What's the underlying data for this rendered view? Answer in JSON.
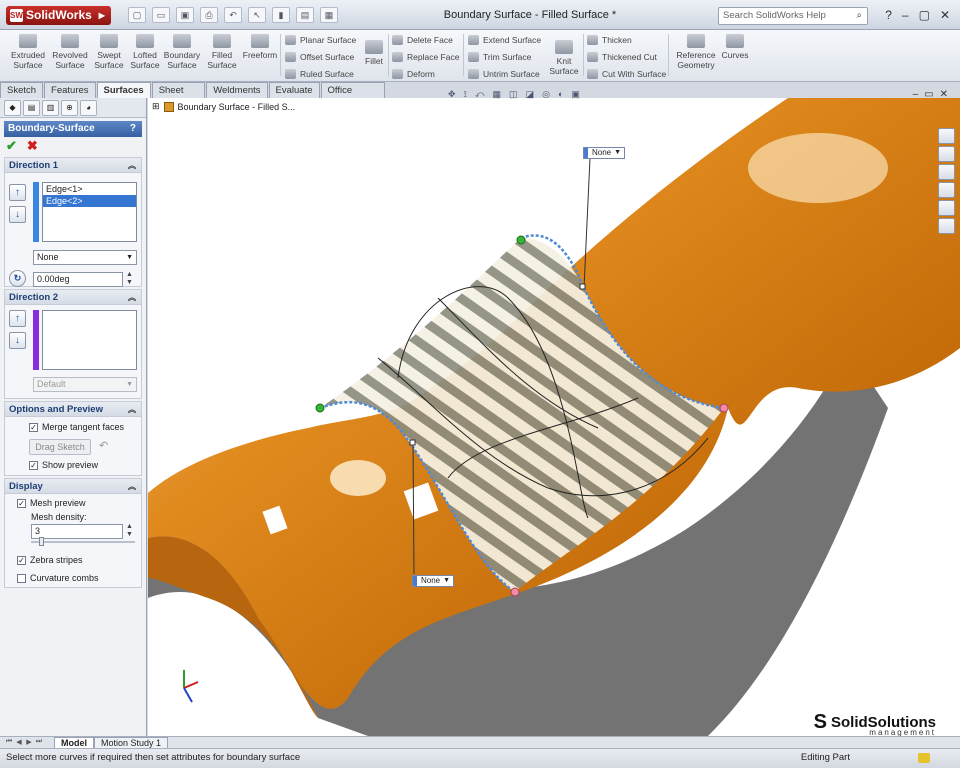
{
  "app": {
    "logo": "SolidWorks",
    "window_title": "Boundary Surface - Filled Surface *",
    "search_placeholder": "Search SolidWorks Help"
  },
  "ribbon": {
    "big_buttons": [
      {
        "label": "Extruded Surface",
        "icon": "extruded-surface-icon"
      },
      {
        "label": "Revolved Surface",
        "icon": "revolved-surface-icon"
      },
      {
        "label": "Swept Surface",
        "icon": "swept-surface-icon"
      },
      {
        "label": "Lofted Surface",
        "icon": "lofted-surface-icon"
      },
      {
        "label": "Boundary Surface",
        "icon": "boundary-surface-icon"
      },
      {
        "label": "Filled Surface",
        "icon": "filled-surface-icon"
      },
      {
        "label": "Freeform",
        "icon": "freeform-icon"
      }
    ],
    "col1": [
      "Planar Surface",
      "Offset Surface",
      "Ruled Surface"
    ],
    "fillet": "Fillet",
    "col2": [
      "Delete Face",
      "Replace Face",
      "Deform"
    ],
    "col3": [
      "Extend Surface",
      "Trim Surface",
      "Untrim Surface"
    ],
    "knit": "Knit Surface",
    "col4": [
      "Thicken",
      "Thickened Cut",
      "Cut With Surface"
    ],
    "reference_geometry": "Reference Geometry",
    "curves": "Curves"
  },
  "tabs": [
    "Sketch",
    "Features",
    "Surfaces",
    "Sheet Metal",
    "Weldments",
    "Evaluate",
    "Office Products"
  ],
  "active_tab": "Surfaces",
  "property_manager": {
    "title": "Boundary-Surface",
    "help": "?",
    "ok_label": "✔",
    "cancel_label": "✖",
    "direction1": {
      "title": "Direction 1",
      "items": [
        "Edge<1>",
        "Edge<2>"
      ],
      "selected_index": 1,
      "tangency": "None",
      "angle": "0.00deg"
    },
    "direction2": {
      "title": "Direction 2",
      "tangency": "Default"
    },
    "options": {
      "title": "Options and Preview",
      "merge_tangent": "Merge tangent faces",
      "drag_sketch": "Drag Sketch",
      "show_preview": "Show preview"
    },
    "display": {
      "title": "Display",
      "mesh_preview": "Mesh preview",
      "mesh_density_label": "Mesh density:",
      "mesh_density": "3",
      "zebra": "Zebra stripes",
      "curvature": "Curvature combs"
    }
  },
  "graphics": {
    "tree_flyout": "Boundary Surface - Filled S...",
    "callout_top": "None",
    "callout_bottom": "None",
    "brand_name": "SolidSolutions",
    "brand_sub": "management"
  },
  "bottom_tabs": [
    "Model",
    "Motion Study 1"
  ],
  "status": {
    "left": "Select more curves if required then set attributes for boundary surface",
    "right": "Editing Part"
  },
  "colors": {
    "surface": "#e08a1e",
    "pm_title": "#3760a2",
    "selected": "#3476d2"
  }
}
